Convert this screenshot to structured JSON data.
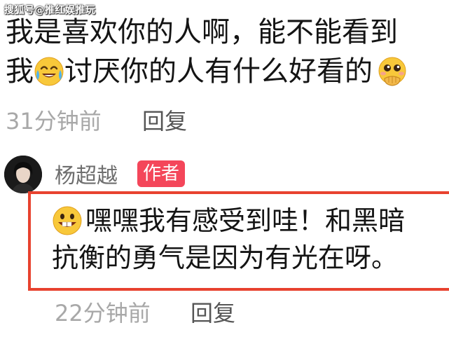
{
  "watermark": {
    "text": "搜狐号@推红娱推玩"
  },
  "comment": {
    "line1": "我是喜欢你的人啊，能不能看到",
    "line2_part1": "我",
    "line2_part2": "讨厌你的人有什么好看的",
    "emoji_1": "crying-laughing-emoji",
    "emoji_2": "pleading-hands-over-mouth-emoji",
    "time": "31分钟前",
    "reply_label": "回复"
  },
  "reply": {
    "username": "杨超越",
    "badge": "作者",
    "emoji": "grinning-teeth-emoji",
    "line1": "嘿嘿我有感受到哇！和黑暗",
    "line2": "抗衡的勇气是因为有光在呀。",
    "time": "22分钟前",
    "reply_label": "回复",
    "highlight_color": "#e8422f",
    "badge_color": "#f4465a"
  }
}
